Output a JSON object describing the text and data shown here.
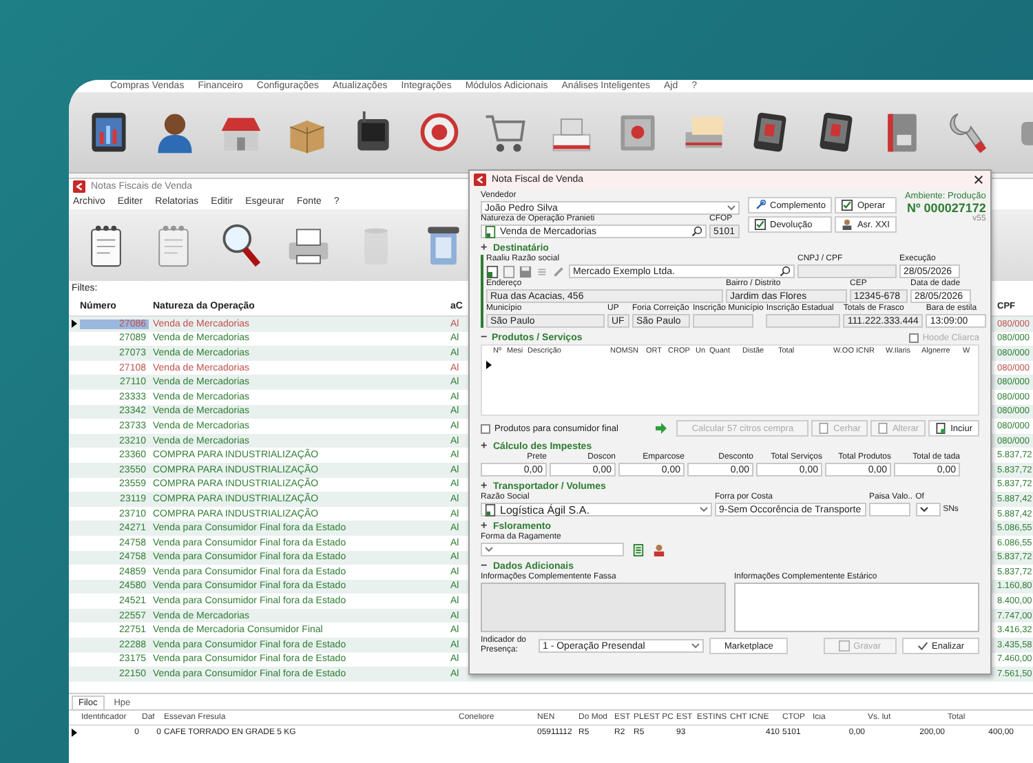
{
  "menu_bar": {
    "items": [
      "Compras Vendas",
      "Financeiro",
      "Configurações",
      "Atualizações",
      "Integrações",
      "Módulos Adicionais",
      "Análises Inteligentes",
      "Ajd",
      "?"
    ]
  },
  "child_window": {
    "title": "Notas Fiscais de Venda",
    "menu": [
      "Archivo",
      "Editer",
      "Relatorias",
      "Editir",
      "Esgeurar",
      "Fonte",
      "?"
    ],
    "filter_label": "Filtes:",
    "table": {
      "columns": [
        "Número",
        "Natureza da Operação",
        "aC",
        "CPF"
      ],
      "rows": [
        {
          "number": "27086",
          "operation": "Venda de Mercadorias",
          "column_3": "Al",
          "column_4": "080/000",
          "color": "#c0504d",
          "selected": true
        },
        {
          "number": "27089",
          "operation": "Venda de Mercadorias",
          "column_3": "Al",
          "column_4": "080/000",
          "color": "#2e7d32",
          "selected": false
        },
        {
          "number": "27073",
          "operation": "Venda de Mercadorias",
          "column_3": "Al",
          "column_4": "080/000",
          "color": "#2e7d32",
          "selected": false
        },
        {
          "number": "27108",
          "operation": "Venda de Mercadorias",
          "column_3": "Al",
          "column_4": "080/000",
          "color": "#c0504d",
          "selected": false
        },
        {
          "number": "27110",
          "operation": "Venda de Mercadorias",
          "column_3": "Al",
          "column_4": "080/000",
          "color": "#2e7d32",
          "selected": false
        },
        {
          "number": "23333",
          "operation": "Venda de Mercadorias",
          "column_3": "Al",
          "column_4": "080/000",
          "color": "#2e7d32",
          "selected": false
        },
        {
          "number": "23342",
          "operation": "Venda de Mercadorias",
          "column_3": "Al",
          "column_4": "080/000",
          "color": "#2e7d32",
          "selected": false
        },
        {
          "number": "23733",
          "operation": "Venda de Mercadorias",
          "column_3": "Al",
          "column_4": "080/000",
          "color": "#2e7d32",
          "selected": false
        },
        {
          "number": "23210",
          "operation": "Venda de Mercadorias",
          "column_3": "Al",
          "column_4": "080/000",
          "color": "#2e7d32",
          "selected": false
        },
        {
          "number": "23360",
          "operation": "COMPRA PARA INDUSTRIALIZAÇÃO",
          "column_3": "Al",
          "column_4": "5.837,72",
          "color": "#2e7d32",
          "selected": false
        },
        {
          "number": "23550",
          "operation": "COMPRA PARA INDUSTRIALIZAÇÃO",
          "column_3": "Al",
          "column_4": "5.837,72",
          "color": "#2e7d32",
          "selected": false
        },
        {
          "number": "23559",
          "operation": "COMPRA PARA INDUSTRIALIZAÇÃO",
          "column_3": "Al",
          "column_4": "5.837,72",
          "color": "#2e7d32",
          "selected": false
        },
        {
          "number": "23119",
          "operation": "COMPRA PARA INDUSTRIALIZAÇÃO",
          "column_3": "Al",
          "column_4": "5.887,42",
          "color": "#2e7d32",
          "selected": false
        },
        {
          "number": "23710",
          "operation": "COMPRA PARA INDUSTRIALIZAÇÃO",
          "column_3": "Al",
          "column_4": "5.887,42",
          "color": "#2e7d32",
          "selected": false
        },
        {
          "number": "24271",
          "operation": "Venda para Consumidor Final fora da Estado",
          "column_3": "Al",
          "column_4": "5.086,55",
          "color": "#2e7d32",
          "selected": false
        },
        {
          "number": "24758",
          "operation": "Venda para Consumidor Final fora da Estado",
          "column_3": "Al",
          "column_4": "6.086,55",
          "color": "#2e7d32",
          "selected": false
        },
        {
          "number": "24758",
          "operation": "Venda para Consumidor Final fora da Estado",
          "column_3": "Al",
          "column_4": "5.837,72",
          "color": "#2e7d32",
          "selected": false
        },
        {
          "number": "24859",
          "operation": "Venda para Consumidor Final fora da Estado",
          "column_3": "Al",
          "column_4": "5.837,72",
          "color": "#2e7d32",
          "selected": false
        },
        {
          "number": "24580",
          "operation": "Venda para Consumidor Final fora da Estado",
          "column_3": "Al",
          "column_4": "1.160,80",
          "color": "#2e7d32",
          "selected": false
        },
        {
          "number": "24521",
          "operation": "Venda para Consumidor Final fora da Estado",
          "column_3": "Al",
          "column_4": "8.400,00",
          "color": "#2e7d32",
          "selected": false
        },
        {
          "number": "22557",
          "operation": "Venda de Mercadorias",
          "column_3": "Al",
          "column_4": "7.747,00",
          "color": "#2e7d32",
          "selected": false
        },
        {
          "number": "22751",
          "operation": "Venda de Mercadoria Consumidor Final",
          "column_3": "Al",
          "column_4": "3.416,32",
          "color": "#2e7d32",
          "selected": false
        },
        {
          "number": "22288",
          "operation": "Venda para Consumidor Final fora de Estado",
          "column_3": "Al",
          "column_4": "3.435,58",
          "color": "#2e7d32",
          "selected": false
        },
        {
          "number": "23175",
          "operation": "Venda para Consumidor Final fora de Estado",
          "column_3": "Al",
          "column_4": "7.460,00",
          "color": "#2e7d32",
          "selected": false
        },
        {
          "number": "22150",
          "operation": "Venda para Consumidor Final fora de Estado",
          "column_3": "Al",
          "column_4": "7.561,50",
          "color": "#2e7d32",
          "selected": false
        }
      ]
    },
    "detail_tabs": [
      {
        "label": "Filoc",
        "selected": true
      },
      {
        "label": "Hpe",
        "selected": false
      }
    ],
    "detail_table": {
      "columns": [
        "Identificador",
        "Daf",
        "Essevan Fresula",
        "Coneliore",
        "NEN",
        "Do Mod",
        "EST",
        "PLEST PC",
        "EST",
        "ESTINS",
        "CHT ICNE",
        "CTOP",
        "Icia",
        "Vs. lut",
        "Total"
      ],
      "rows": [
        {
          "selected": true,
          "cells": [
            "0",
            "0",
            "CAFE TORRADO EN GRADE 5 KG",
            "",
            "05911112",
            "R5",
            "R2",
            "R5",
            "93",
            "",
            "410",
            "5101",
            "0,00",
            "200,00",
            "400,00"
          ]
        }
      ]
    }
  },
  "dialog": {
    "title": "Nota Fiscal de Venda",
    "seller": {
      "label": "Vendedor",
      "value": "João Pedro Silva"
    },
    "actions": [
      {
        "label": "Complemento",
        "kind": "link"
      },
      {
        "label": "Operar",
        "kind": "check"
      },
      {
        "label": "Devolução",
        "kind": "check"
      },
      {
        "label": "Asr. XXI",
        "kind": "person"
      }
    ],
    "environment": "Ambiente: Produção",
    "number": "Nº 000027172",
    "version": "v55",
    "operation": {
      "label": "Natureza de Operação Pranieti",
      "value": "Venda de Mercadorias"
    },
    "cfop": {
      "label": "CFOP",
      "value": "5101"
    },
    "recipient": {
      "title": "Destinatário",
      "toggle": "+",
      "company": {
        "label": "Raaliu Razão social",
        "value": "Mercado Exemplo Ltda."
      },
      "tax_id": {
        "label": "CNPJ / CPF"
      },
      "issue_date": {
        "label": "Execução",
        "value": "28/05/2026"
      },
      "address_fields": [
        {
          "label": "Endereço",
          "value": "Rua das Acacias, 456"
        },
        {
          "label": "Bairro / Distrito",
          "value": "Jardim das Flores"
        },
        {
          "label": "CEP",
          "value": "12345-678"
        },
        {
          "label": "Data de dade",
          "value": "28/05/2026"
        }
      ],
      "location_fields": [
        {
          "label": "Município",
          "value": "São Paulo"
        },
        {
          "label": "UP",
          "value": "UF"
        },
        {
          "label": "Foria Correição",
          "value": "São Paulo"
        },
        {
          "label": "Inscrição Município"
        },
        {
          "label": "Inscrição Estadual"
        },
        {
          "label": "Totals de Frasco",
          "value": "111.222.333.444"
        },
        {
          "label": "Bara de estila",
          "value": "13:09:00"
        }
      ]
    },
    "products": {
      "title": "Produtos / Serviços",
      "toggle": "−",
      "option": {
        "label": "Hoode Cliarca",
        "checked": false,
        "disabled": true
      },
      "columns": [
        "Nº",
        "Mesi",
        "Descrição",
        "NOMSN",
        "ORT",
        "CROP",
        "Un",
        "Quant",
        "Distãe",
        "Total",
        "W.OO ICNR",
        "W.Ilaris",
        "Algnerre",
        "W"
      ]
    },
    "consumer_option": {
      "label": "Produtos para consumidor final",
      "checked": false
    },
    "item_buttons": [
      {
        "label": "Calcular 57 citros cempra",
        "kind": "text",
        "disabled": true
      },
      {
        "label": "Cerhar",
        "kind": "doc",
        "disabled": true
      },
      {
        "label": "Alterar",
        "kind": "doc",
        "disabled": true
      },
      {
        "label": "Inciur",
        "kind": "new",
        "disabled": false
      }
    ],
    "taxes": {
      "title": "Cálculo des Impestes",
      "toggle": "+",
      "fields": [
        {
          "label": "Prete",
          "value": "0,00"
        },
        {
          "label": "Doscon",
          "value": "0,00"
        },
        {
          "label": "Emparcose",
          "value": "0,00"
        },
        {
          "label": "Desconto",
          "value": "0,00"
        },
        {
          "label": "Total Serviços",
          "value": "0,00"
        },
        {
          "label": "Total Produtos",
          "value": "0,00"
        },
        {
          "label": "Total de tada",
          "value": "0,00"
        }
      ]
    },
    "transport": {
      "title": "Transportador / Volumes",
      "toggle": "+",
      "carrier": {
        "label": "Razão Social",
        "value": "Logística Ágil S.A."
      },
      "freight": {
        "label": "Forra por Costa",
        "value": "9-Sem Occorência de Transporte"
      },
      "amount": {
        "label": "Paisa Valo.."
      },
      "of_field": {
        "label": "Of"
      },
      "suffix": "SNs"
    },
    "billing": {
      "title": "Fsloramento",
      "toggle": "+",
      "payment": {
        "label": "Forma da Ragamente"
      }
    },
    "additional": {
      "title": "Dados Adicionais",
      "toggle": "−",
      "notes": [
        {
          "label": "Informações Complementente Fassa",
          "disabled": true
        },
        {
          "label": "Informações Complementente Estárico",
          "disabled": false
        }
      ]
    },
    "footer": {
      "presence_label": "Indicador do Presença:",
      "presence_value": "1 - Operação Presendal",
      "buttons": [
        {
          "label": "Marketplace",
          "kind": "text",
          "disabled": false
        },
        {
          "label": "Gravar",
          "kind": "save",
          "disabled": true
        },
        {
          "label": "Enalizar",
          "kind": "check",
          "disabled": false
        }
      ]
    }
  }
}
